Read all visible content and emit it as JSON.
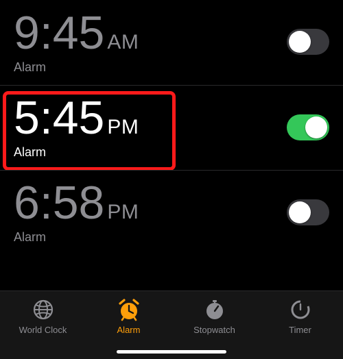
{
  "colors": {
    "accent": "#ff9f0a",
    "toggle_on": "#34c759",
    "toggle_off": "#39393d",
    "inactive": "#8e8e93",
    "highlight": "#ff1a1a"
  },
  "alarms": [
    {
      "time": "9:45",
      "period": "AM",
      "label": "Alarm",
      "enabled": false,
      "highlighted": false
    },
    {
      "time": "5:45",
      "period": "PM",
      "label": "Alarm",
      "enabled": true,
      "highlighted": true
    },
    {
      "time": "6:58",
      "period": "PM",
      "label": "Alarm",
      "enabled": false,
      "highlighted": false
    }
  ],
  "tabs": [
    {
      "id": "world-clock",
      "label": "World Clock",
      "active": false
    },
    {
      "id": "alarm",
      "label": "Alarm",
      "active": true
    },
    {
      "id": "stopwatch",
      "label": "Stopwatch",
      "active": false
    },
    {
      "id": "timer",
      "label": "Timer",
      "active": false
    }
  ]
}
